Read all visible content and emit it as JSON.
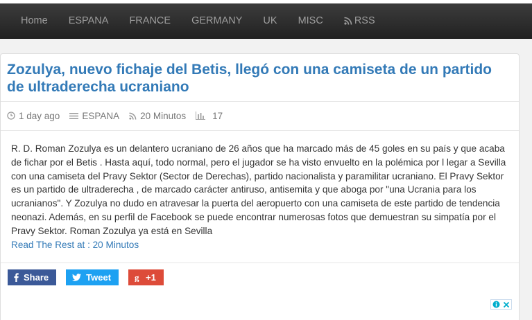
{
  "nav": {
    "items": [
      "Home",
      "ESPANA",
      "FRANCE",
      "GERMANY",
      "UK",
      "MISC"
    ],
    "rss_label": "RSS"
  },
  "article": {
    "title": "Zozulya, nuevo fichaje del Betis, llegó con una camiseta de un partido de ultraderecha ucraniano",
    "time_ago": "1 day ago",
    "category": "ESPANA",
    "source": "20 Minutos",
    "views": "17",
    "body": "R. D. Roman Zozulya es un delantero ucraniano de 26 años que ha marcado más de 45 goles en su país y que acaba de fichar por el Betis . Hasta aquí, todo normal, pero el jugador se ha visto envuelto en la polémica por l legar a Sevilla con una camiseta del Pravy Sektor (Sector de Derechas), partido nacionalista y paramilitar ucraniano. El Pravy Sektor es un partido de ultraderecha , de marcado carácter antiruso, antisemita y que aboga por \"una Ucrania para los ucranianos\". Y Zozulya no dudo en atravesar la puerta del aeropuerto con una camiseta de este partido de tendencia neonazi. Además, en su perfil de Facebook se puede encontrar numerosas fotos que demuestran su simpatía por el Pravy Sektor. Roman Zozulya ya está en Sevilla",
    "read_more": "Read The Rest at : 20 Minutos"
  },
  "share": {
    "facebook": "Share",
    "twitter": "Tweet",
    "gplus": "+1"
  },
  "colors": {
    "link": "#337ab7",
    "facebook": "#3b5998",
    "twitter": "#1da1f2",
    "gplus": "#dd4b39",
    "navbar": "#222222"
  }
}
